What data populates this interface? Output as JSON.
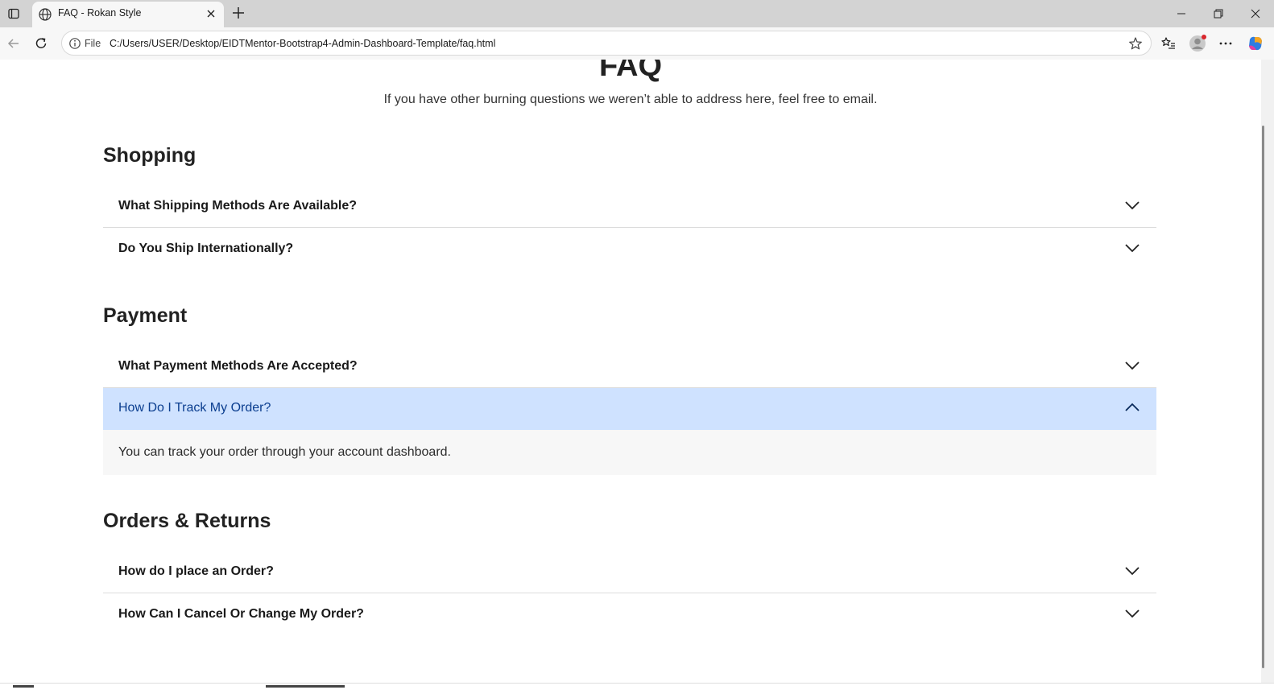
{
  "browser": {
    "tab_title": "FAQ - Rokan Style",
    "file_label": "File",
    "url": "C:/Users/USER/Desktop/EIDTMentor-Bootstrap4-Admin-Dashboard-Template/faq.html"
  },
  "faq": {
    "title": "FAQ",
    "subtitle": "If you have other burning questions we weren’t able to address here, feel free to email."
  },
  "sections": [
    {
      "title": "Shopping",
      "items": [
        {
          "question": "What Shipping Methods Are Available?",
          "expanded": false
        },
        {
          "question": "Do You Ship Internationally?",
          "expanded": false
        }
      ]
    },
    {
      "title": "Payment",
      "items": [
        {
          "question": "What Payment Methods Are Accepted?",
          "expanded": false
        },
        {
          "question": "How Do I Track My Order?",
          "expanded": true,
          "answer": "You can track your order through your account dashboard."
        }
      ]
    },
    {
      "title": "Orders & Returns",
      "items": [
        {
          "question": "How do I place an Order?",
          "expanded": false
        },
        {
          "question": "How Can I Cancel Or Change My Order?",
          "expanded": false
        }
      ]
    }
  ],
  "colors": {
    "active_bg": "#cfe2ff",
    "active_text": "#0a3d8f",
    "answer_bg": "#f7f7f7"
  },
  "icons": [
    "tab-actions-icon",
    "globe-icon",
    "close-icon",
    "plus-icon",
    "minimize-icon",
    "restore-icon",
    "back-icon",
    "refresh-icon",
    "info-icon",
    "star-icon",
    "favorites-icon",
    "profile-icon",
    "more-icon",
    "copilot-icon",
    "chevron-down-icon",
    "chevron-up-icon"
  ]
}
